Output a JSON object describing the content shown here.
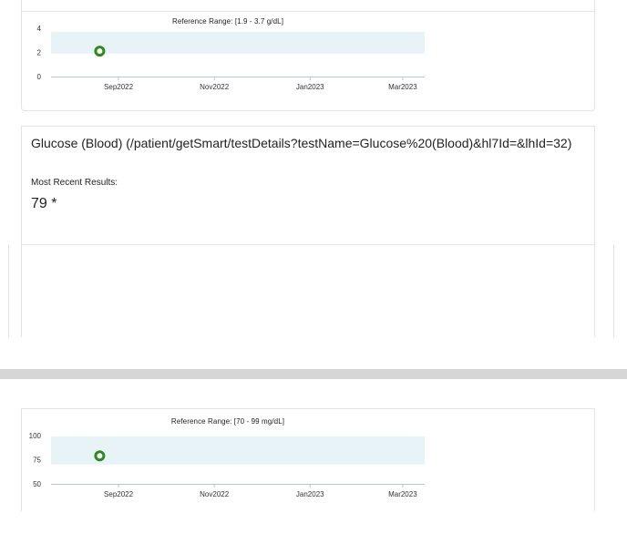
{
  "charts": [
    {
      "reference_range": "Reference Range: [1.9 - 3.7 g/dL]",
      "y_ticks": [
        "4",
        "2",
        "0"
      ],
      "x_ticks": [
        "Sep2022",
        "Nov2022",
        "Jan2023",
        "Mar2023"
      ],
      "colors": {
        "band": "#e8f3f8",
        "point": "#2e8b1e",
        "axis": "#b9c7cf"
      }
    },
    {
      "reference_range": "Reference Range: [70 - 99 mg/dL]",
      "y_ticks": [
        "100",
        "75",
        "50"
      ],
      "x_ticks": [
        "Sep2022",
        "Nov2022",
        "Jan2023",
        "Mar2023"
      ],
      "colors": {
        "band": "#e8f3f8",
        "point": "#2e8b1e",
        "axis": "#b9c7cf"
      }
    }
  ],
  "chart_data": [
    {
      "type": "scatter",
      "title": "Reference Range: [1.9 - 3.7 g/dL]",
      "x_ticks": [
        "Sep2022",
        "Nov2022",
        "Jan2023",
        "Mar2023"
      ],
      "ylim": [
        0,
        4
      ],
      "reference_band": [
        1.9,
        3.7
      ],
      "points": [
        {
          "x": "2022-08-20",
          "y": 2.1
        }
      ]
    },
    {
      "type": "scatter",
      "title": "Reference Range: [70 - 99 mg/dL]",
      "x_ticks": [
        "Sep2022",
        "Nov2022",
        "Jan2023",
        "Mar2023"
      ],
      "ylim": [
        50,
        100
      ],
      "reference_band": [
        70,
        99
      ],
      "points": [
        {
          "x": "2022-08-20",
          "y": 79
        }
      ]
    }
  ],
  "test": {
    "title": "Glucose (Blood) (/patient/getSmart/testDetails?testName=Glucose%20(Blood)&hl7Id=&lhId=32)",
    "recent_label": "Most Recent Results:",
    "recent_value": "79 *"
  }
}
